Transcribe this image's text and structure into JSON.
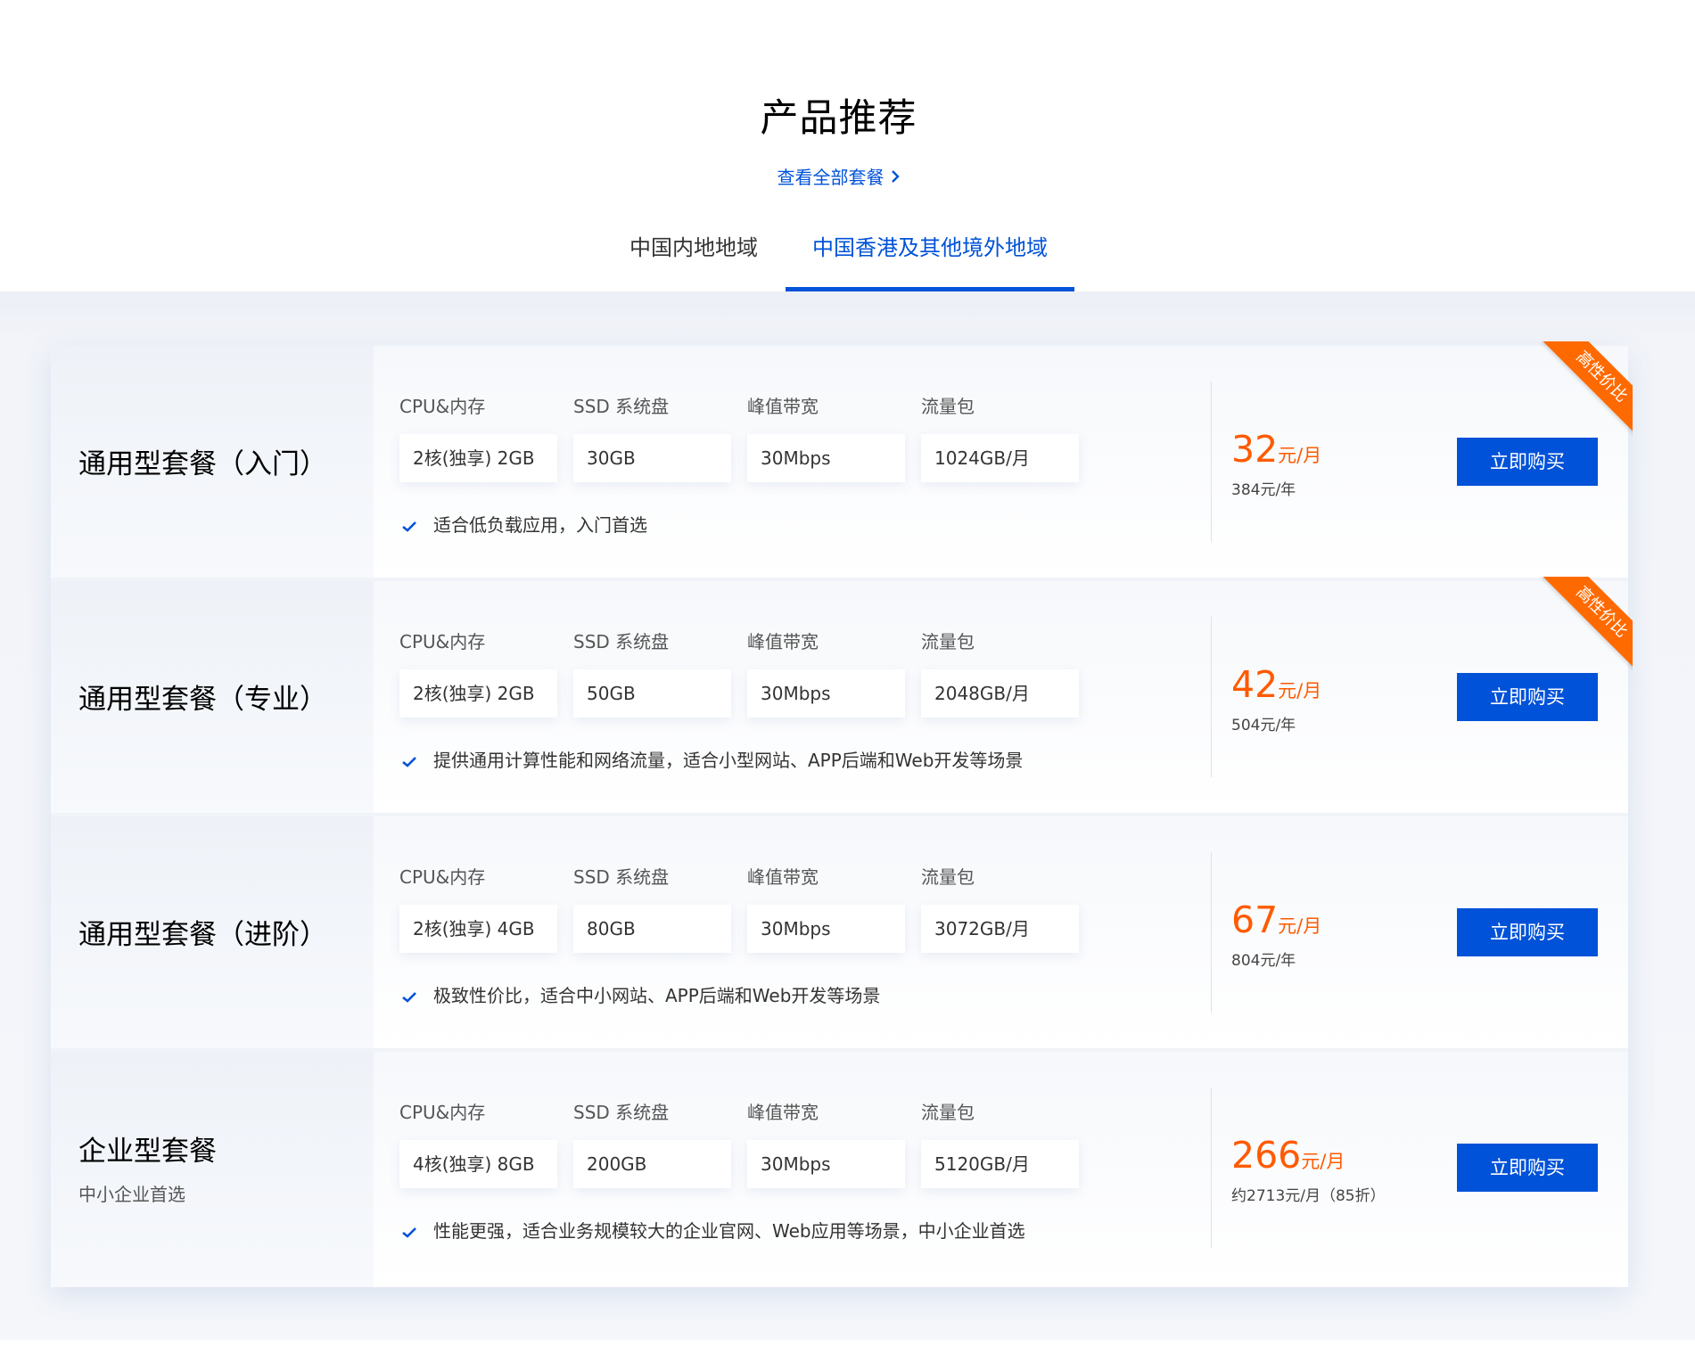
{
  "section": {
    "title": "产品推荐",
    "view_all": "查看全部套餐"
  },
  "tabs": [
    {
      "label": "中国内地地域",
      "active": false
    },
    {
      "label": "中国香港及其他境外地域",
      "active": true
    }
  ],
  "spec_labels": [
    "CPU&内存",
    "SSD 系统盘",
    "峰值带宽",
    "流量包"
  ],
  "buy_label": "立即购买",
  "ribbon_label": "高性价比",
  "colors": {
    "accent": "#0052d9",
    "price": "#ff5a00",
    "ribbon": "#ff6a00"
  },
  "plans": [
    {
      "name": "通用型套餐（入门）",
      "subtitle": "",
      "specs": [
        "2核(独享) 2GB",
        "30GB",
        "30Mbps",
        "1024GB/月"
      ],
      "feature": "适合低负载应用，入门首选",
      "price": "32",
      "price_unit": "元/月",
      "price_alt": "384元/年",
      "ribbon": true
    },
    {
      "name": "通用型套餐（专业）",
      "subtitle": "",
      "specs": [
        "2核(独享) 2GB",
        "50GB",
        "30Mbps",
        "2048GB/月"
      ],
      "feature": "提供通用计算性能和网络流量，适合小型网站、APP后端和Web开发等场景",
      "price": "42",
      "price_unit": "元/月",
      "price_alt": "504元/年",
      "ribbon": true
    },
    {
      "name": "通用型套餐（进阶）",
      "subtitle": "",
      "specs": [
        "2核(独享) 4GB",
        "80GB",
        "30Mbps",
        "3072GB/月"
      ],
      "feature": "极致性价比，适合中小网站、APP后端和Web开发等场景",
      "price": "67",
      "price_unit": "元/月",
      "price_alt": "804元/年",
      "ribbon": false
    },
    {
      "name": "企业型套餐",
      "subtitle": "中小企业首选",
      "specs": [
        "4核(独享) 8GB",
        "200GB",
        "30Mbps",
        "5120GB/月"
      ],
      "feature": "性能更强，适合业务规模较大的企业官网、Web应用等场景，中小企业首选",
      "price": "266",
      "price_unit": "元/月",
      "price_alt": "约2713元/月（85折）",
      "ribbon": false
    }
  ]
}
